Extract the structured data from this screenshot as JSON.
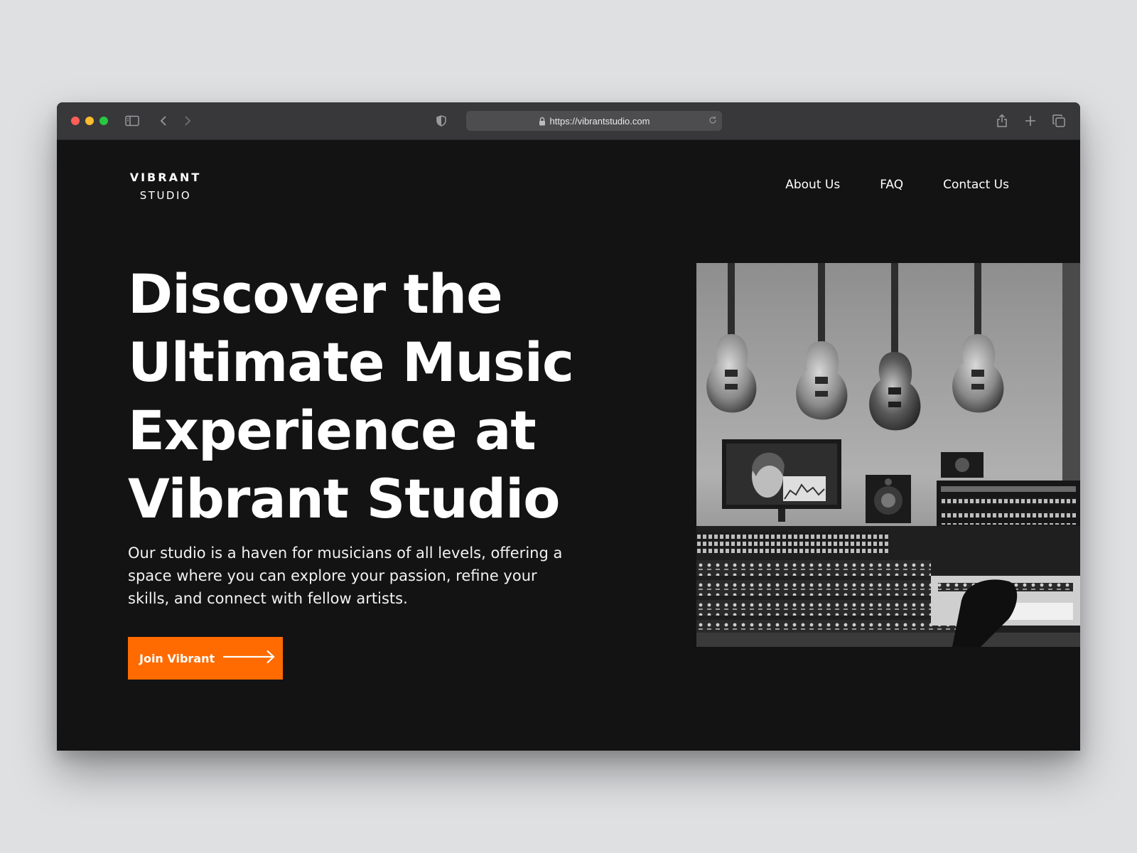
{
  "browser": {
    "url": "https://vibrantstudio.com",
    "traffic_lights": [
      "#ff5f57",
      "#febc2e",
      "#28c840"
    ],
    "icons": [
      "sidebar-icon",
      "back-icon",
      "forward-icon",
      "shield-icon",
      "lock-icon",
      "reload-icon",
      "share-icon",
      "new-tab-icon",
      "tabs-overview-icon"
    ]
  },
  "site": {
    "logo": {
      "line1": "VIBRANT",
      "line2": "STUDIO"
    },
    "nav": [
      {
        "label": "About Us"
      },
      {
        "label": "FAQ"
      },
      {
        "label": "Contact Us"
      }
    ],
    "hero": {
      "headline": "Discover the Ultimate Music Experience at Vibrant Studio",
      "subtext": "Our studio is a haven for musicians of all levels, offering a space where you can explore your passion, refine your skills, and connect with fellow artists.",
      "cta_label": "Join Vibrant",
      "cta_icon": "arrow-right-icon",
      "image_icon": "studio-photo"
    },
    "colors": {
      "background": "#131314",
      "accent": "#ff6b00",
      "text": "#ffffff"
    }
  }
}
